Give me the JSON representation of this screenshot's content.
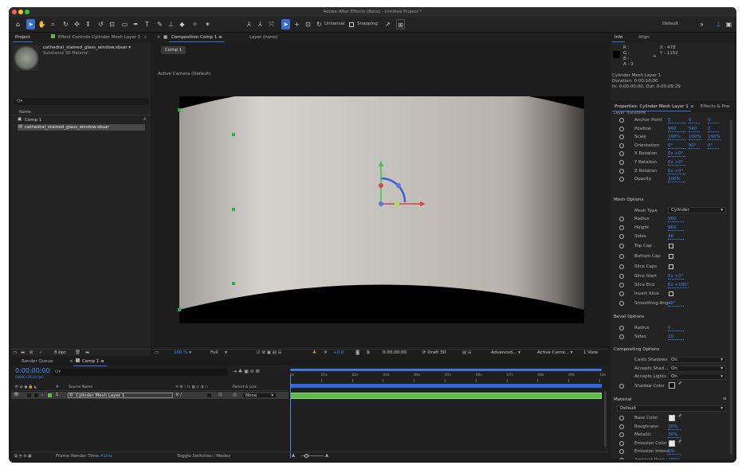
{
  "window": {
    "title": "Adobe After Effects (Beta) - Untitled Project *"
  },
  "toolbar": {
    "universal": "Universal",
    "snapping": "Snapping",
    "workspace": "Default"
  },
  "project_panel": {
    "tab_project": "Project",
    "tab_effect_controls": "Effect Controls Cylinder Mesh Layer 1",
    "asset_name": "cathedral_stained_glass_window.sbsar ▾",
    "asset_type": "Substance 3D Material",
    "search_placeholder": "Q▾",
    "col_name": "Name",
    "items": [
      {
        "name": "Comp 1"
      },
      {
        "name": "cathedral_stained_glass_window.sbsar"
      }
    ],
    "bpc": "8 bpc"
  },
  "comp_panel": {
    "tab_comp": "Composition Comp 1",
    "tab_layer": "Layer (none)",
    "comp_button": "Comp 1",
    "camera_label": "Active Camera (Default)",
    "zoom": "100 %",
    "resolution": "Full",
    "exposure": "+0.0",
    "timecode": "0:00:00:00",
    "renderer": "Draft 3D",
    "advanced": "Advanced...",
    "camera": "Active Came...",
    "view": "1 View"
  },
  "info_panel": {
    "tab_info": "Info",
    "tab_align": "Align",
    "r": "R :",
    "g": "G :",
    "b": "B :",
    "a": "A : 0",
    "x": "X : 478",
    "y": "Y : 1152",
    "layer_name": "Cylinder Mesh Layer 1",
    "duration": "Duration: 0:00:10:00",
    "in_out": "In: 0:00:00:00, Out: 0:00:09:29"
  },
  "properties": {
    "tab_props": "Properties: Cylinder Mesh Layer 1",
    "tab_effects": "Effects & Pre",
    "layer_transform": "Layer Transform",
    "transform": [
      {
        "label": "Anchor Point",
        "v1": "0",
        "v2": "0",
        "v3": "0"
      },
      {
        "label": "Position",
        "v1": "960",
        "v2": "540",
        "v3": "0"
      },
      {
        "label": "Scale",
        "v1": "100%",
        "v2": "100%",
        "v3": "100%"
      },
      {
        "label": "Orientation",
        "v1": "0°",
        "v2": "90°",
        "v3": "0°"
      },
      {
        "label": "X Rotation",
        "v1": "0x +0°"
      },
      {
        "label": "Y Rotation",
        "v1": "0x +0°"
      },
      {
        "label": "Z Rotation",
        "v1": "0x +0°"
      },
      {
        "label": "Opacity",
        "v1": "100%"
      }
    ],
    "mesh_options": "Mesh Options",
    "mesh_type_label": "Mesh Type",
    "mesh_type_value": "Cylinder",
    "mesh": [
      {
        "label": "Radius",
        "value": "960",
        "kind": "num"
      },
      {
        "label": "Height",
        "value": "960",
        "kind": "num"
      },
      {
        "label": "Sides",
        "value": "48",
        "kind": "num"
      },
      {
        "label": "Top Cap",
        "value": "",
        "kind": "check"
      },
      {
        "label": "Bottom Cap",
        "value": "",
        "kind": "check"
      },
      {
        "label": "Slice Caps",
        "value": "",
        "kind": "check"
      },
      {
        "label": "Slice Start",
        "value": "0x +0°",
        "kind": "num"
      },
      {
        "label": "Slice End",
        "value": "0x +180°",
        "kind": "num"
      },
      {
        "label": "Invert Slice",
        "value": "",
        "kind": "check"
      },
      {
        "label": "Smoothing Ang...",
        "value": "40°",
        "kind": "num"
      }
    ],
    "bevel_options": "Bevel Options",
    "bevel": [
      {
        "label": "Radius",
        "value": "0"
      },
      {
        "label": "Sides",
        "value": "20"
      }
    ],
    "compositing_options": "Compositing Options",
    "compositing": [
      {
        "label": "Casts Shadows",
        "value": "On"
      },
      {
        "label": "Accepts Shad...",
        "value": "On"
      },
      {
        "label": "Accepts Lights",
        "value": "On"
      }
    ],
    "shadow_color": "Shadow Color",
    "material": "Material",
    "material_preset": "Default",
    "material_props": [
      {
        "label": "Base Color",
        "value": "",
        "kind": "color"
      },
      {
        "label": "Roughness",
        "value": "30%",
        "kind": "num"
      },
      {
        "label": "Metallic",
        "value": "30%",
        "kind": "num"
      },
      {
        "label": "Emission Color",
        "value": "",
        "kind": "color"
      },
      {
        "label": "Emission Intens...",
        "value": "0%",
        "kind": "num"
      },
      {
        "label": "Ambient Resp...",
        "value": "100%",
        "kind": "num"
      }
    ]
  },
  "timeline": {
    "tab_render_queue": "Render Queue",
    "tab_comp": "Comp 1",
    "timecode": "0:00:00:00",
    "timecode_sub": "00000 (30.00 fps)",
    "search_placeholder": "Q▾",
    "col_num": "#",
    "col_source": "Source Name",
    "col_parent": "Parent & Link",
    "layer_num": "1",
    "layer_name": "Cylinder Mesh Layer 1",
    "parent_value": "None",
    "ruler": [
      "0s",
      "01s",
      "02s",
      "03s",
      "04s",
      "05s",
      "06s",
      "07s",
      "08s",
      "09s",
      "10s"
    ],
    "frame_render_label": "Frame Render Time:",
    "frame_render_value": "41ms",
    "toggle": "Toggle Switches / Modes"
  }
}
